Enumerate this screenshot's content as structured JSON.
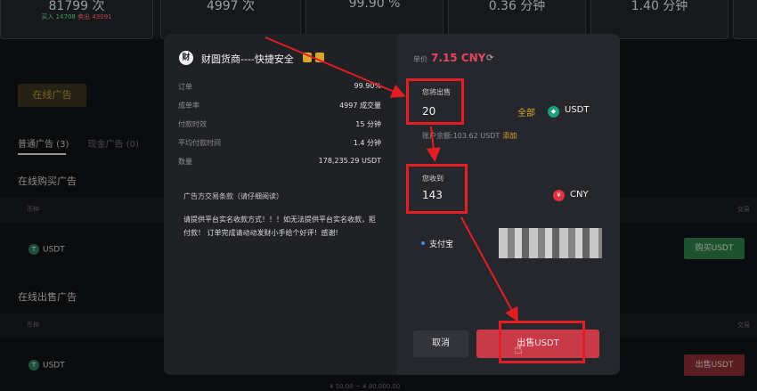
{
  "background": {
    "stats": [
      {
        "value": "81799 次",
        "sub_buy": "买入 14708",
        "sub_sell": "卖出 43091"
      },
      {
        "value": "4997 次"
      },
      {
        "value": "99.90 %"
      },
      {
        "value": "0.36 分钟"
      },
      {
        "value": "1.40 分钟"
      }
    ],
    "online_ads_button": "在线广告",
    "tabs": [
      {
        "label": "普通广告 (3)"
      },
      {
        "label": "现金广告 (0)"
      }
    ],
    "buy_section_title": "在线购买广告",
    "sell_section_title": "在线出售广告",
    "col_coin": "币种",
    "col_trade": "交易",
    "coin_name": "USDT",
    "buy_button": "购买USDT",
    "sell_button": "出售USDT",
    "amount_range": "¥ 50.00 ~ ¥ 80,000.00"
  },
  "modal": {
    "merchant": {
      "avatar_char": "财",
      "name": "财圆货商----快捷安全"
    },
    "stats": [
      {
        "key": "订单",
        "value": "99.90%"
      },
      {
        "key": "成单率",
        "value": "4997 成交量"
      },
      {
        "key": "付款时效",
        "value": "15 分钟"
      },
      {
        "key": "平均付款时间",
        "value": "1.4 分钟"
      },
      {
        "key": "数量",
        "value": "178,235.29 USDT"
      }
    ],
    "terms_title": "广告方交易条款（请仔细阅读）",
    "terms_body": "请提供平台实名收款方式！！！如无法提供平台实名收款，拒付款！ 订单完成请动动发财小手给个好评！感谢!",
    "price_label": "单价",
    "price_value": "7.15 CNY",
    "sell_label": "您将出售",
    "sell_amount": "20",
    "all_button": "全部",
    "sell_currency": "USDT",
    "balance_label": "账户余额:103.62 USDT",
    "add_link": "添加",
    "receive_label": "您收到",
    "receive_amount": "143",
    "receive_currency": "CNY",
    "payment_method": "支付宝",
    "cancel_button": "取消",
    "confirm_button": "出售USDT"
  }
}
